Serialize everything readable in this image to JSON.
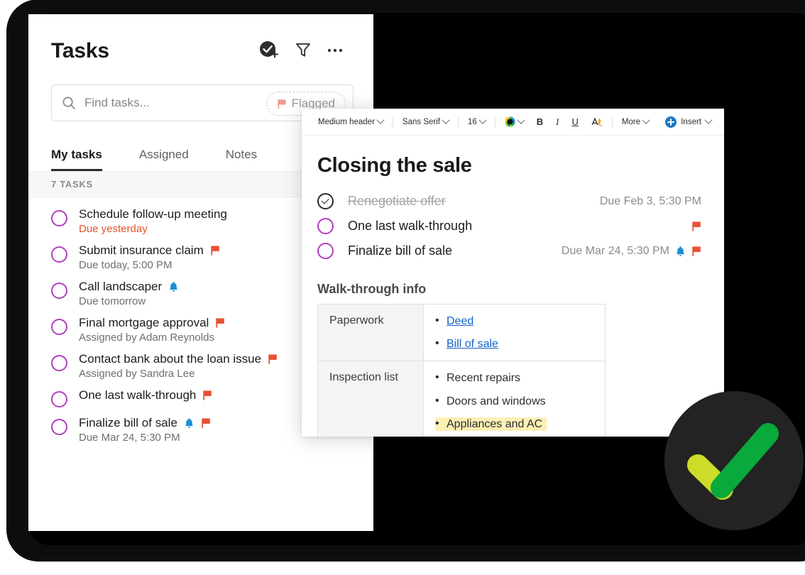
{
  "tasks_panel": {
    "title": "Tasks",
    "header_icons": [
      {
        "name": "add-task-icon"
      },
      {
        "name": "filter-icon"
      },
      {
        "name": "more-options-icon"
      }
    ],
    "search": {
      "placeholder": "Find tasks...",
      "value": "",
      "chip_label": "Flagged"
    },
    "tabs": [
      {
        "label": "My tasks",
        "active": true
      },
      {
        "label": "Assigned",
        "active": false
      },
      {
        "label": "Notes",
        "active": false
      }
    ],
    "count_label": "7 TASKS",
    "items": [
      {
        "title": "Schedule follow-up meeting",
        "sub": "Due yesterday",
        "overdue": true,
        "bell": false,
        "flag": false
      },
      {
        "title": "Submit insurance claim",
        "sub": "Due today, 5:00 PM",
        "overdue": false,
        "bell": false,
        "flag": true
      },
      {
        "title": "Call landscaper",
        "sub": "Due tomorrow",
        "overdue": false,
        "bell": true,
        "flag": false
      },
      {
        "title": "Final mortgage approval",
        "sub": "Assigned by Adam Reynolds",
        "overdue": false,
        "bell": false,
        "flag": true
      },
      {
        "title": "Contact bank about the loan issue",
        "sub": "Assigned by Sandra Lee",
        "overdue": false,
        "bell": false,
        "flag": true
      },
      {
        "title": "One last walk-through",
        "sub": "",
        "overdue": false,
        "bell": false,
        "flag": true
      },
      {
        "title": "Finalize bill of sale",
        "sub": "Due Mar 24, 5:30 PM",
        "overdue": false,
        "bell": true,
        "flag": true
      }
    ]
  },
  "note_panel": {
    "toolbar": {
      "style": "Medium header",
      "font": "Sans Serif",
      "size": "16",
      "bold": "B",
      "italic": "I",
      "underline": "U",
      "more": "More",
      "insert": "Insert"
    },
    "title": "Closing the sale",
    "tasks": [
      {
        "label": "Renegotiate offer",
        "done": true,
        "meta": "Due Feb 3, 5:30 PM",
        "bell": false,
        "flag": false
      },
      {
        "label": "One last walk-through",
        "done": false,
        "meta": "",
        "bell": false,
        "flag": true
      },
      {
        "label": "Finalize bill of sale",
        "done": false,
        "meta": "Due Mar 24, 5:30 PM",
        "bell": true,
        "flag": true
      }
    ],
    "section_title": "Walk-through info",
    "table": [
      {
        "header": "Paperwork",
        "items": [
          {
            "text": "Deed",
            "link": true,
            "highlight": false
          },
          {
            "text": "Bill of sale",
            "link": true,
            "highlight": false
          }
        ]
      },
      {
        "header": "Inspection list",
        "items": [
          {
            "text": "Recent repairs",
            "link": false,
            "highlight": false
          },
          {
            "text": "Doors and windows",
            "link": false,
            "highlight": false
          },
          {
            "text": "Appliances and AC",
            "link": false,
            "highlight": true
          }
        ]
      }
    ]
  },
  "badge": {
    "name": "green-checkmark-badge",
    "circle_color": "#232323",
    "check_color_short": "#cddc28",
    "check_color_long": "#0aa93c"
  },
  "colors": {
    "accent_purple": "#b13ec0",
    "flag_red": "#ea4f35",
    "bell_blue": "#1b8fd4",
    "link_blue": "#1464c8",
    "overdue": "#e8532b",
    "highlight": "#fdf0b5"
  }
}
